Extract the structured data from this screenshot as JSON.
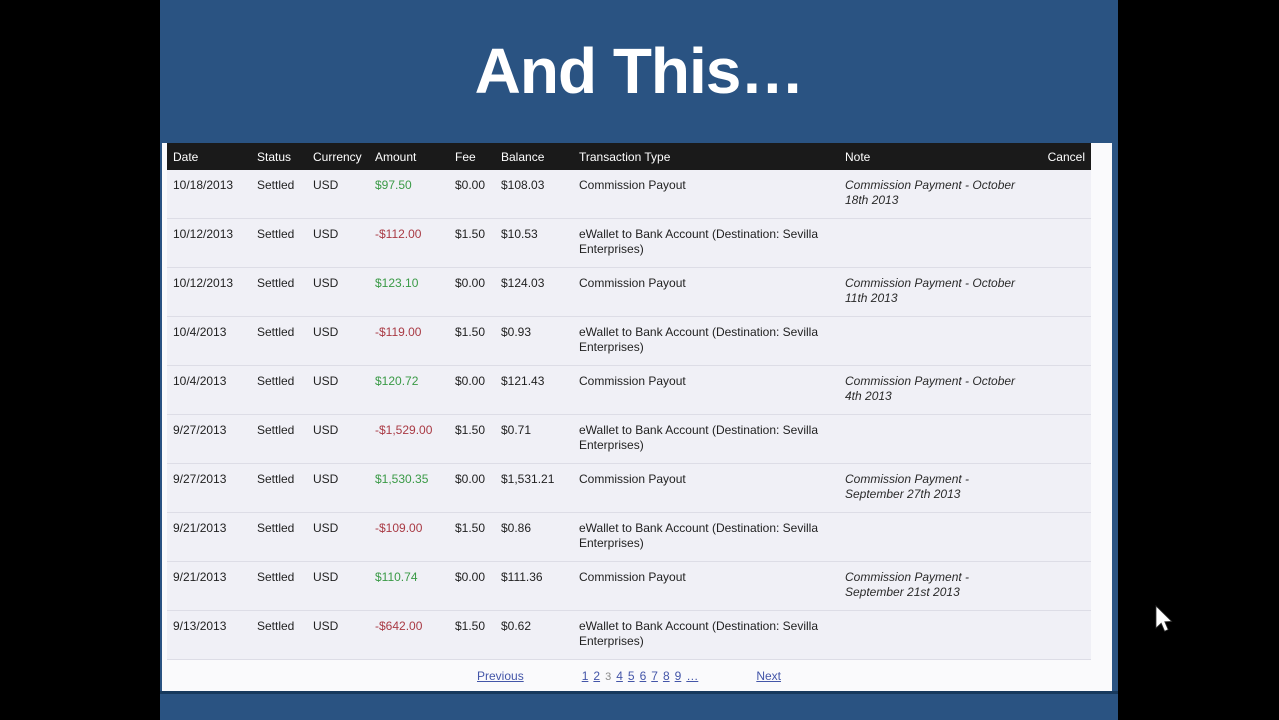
{
  "slide": {
    "title": "And This…"
  },
  "table": {
    "headers": {
      "date": "Date",
      "status": "Status",
      "currency": "Currency",
      "amount": "Amount",
      "fee": "Fee",
      "balance": "Balance",
      "type": "Transaction Type",
      "note": "Note",
      "cancel": "Cancel"
    },
    "rows": [
      {
        "date": "10/18/2013",
        "status": "Settled",
        "currency": "USD",
        "amount": "$97.50",
        "fee": "$0.00",
        "balance": "$108.03",
        "type": "Commission Payout",
        "note": "Commission Payment - October 18th 2013",
        "cancel": ""
      },
      {
        "date": "10/12/2013",
        "status": "Settled",
        "currency": "USD",
        "amount": "-$112.00",
        "fee": "$1.50",
        "balance": "$10.53",
        "type": "eWallet to Bank Account (Destination: Sevilla Enterprises)",
        "note": "",
        "cancel": ""
      },
      {
        "date": "10/12/2013",
        "status": "Settled",
        "currency": "USD",
        "amount": "$123.10",
        "fee": "$0.00",
        "balance": "$124.03",
        "type": "Commission Payout",
        "note": "Commission Payment - October 11th 2013",
        "cancel": ""
      },
      {
        "date": "10/4/2013",
        "status": "Settled",
        "currency": "USD",
        "amount": "-$119.00",
        "fee": "$1.50",
        "balance": "$0.93",
        "type": "eWallet to Bank Account (Destination: Sevilla Enterprises)",
        "note": "",
        "cancel": ""
      },
      {
        "date": "10/4/2013",
        "status": "Settled",
        "currency": "USD",
        "amount": "$120.72",
        "fee": "$0.00",
        "balance": "$121.43",
        "type": "Commission Payout",
        "note": "Commission Payment - October 4th 2013",
        "cancel": ""
      },
      {
        "date": "9/27/2013",
        "status": "Settled",
        "currency": "USD",
        "amount": "-$1,529.00",
        "fee": "$1.50",
        "balance": "$0.71",
        "type": "eWallet to Bank Account (Destination: Sevilla Enterprises)",
        "note": "",
        "cancel": ""
      },
      {
        "date": "9/27/2013",
        "status": "Settled",
        "currency": "USD",
        "amount": "$1,530.35",
        "fee": "$0.00",
        "balance": "$1,531.21",
        "type": "Commission Payout",
        "note": "Commission Payment - September 27th 2013",
        "cancel": ""
      },
      {
        "date": "9/21/2013",
        "status": "Settled",
        "currency": "USD",
        "amount": "-$109.00",
        "fee": "$1.50",
        "balance": "$0.86",
        "type": "eWallet to Bank Account (Destination: Sevilla Enterprises)",
        "note": "",
        "cancel": ""
      },
      {
        "date": "9/21/2013",
        "status": "Settled",
        "currency": "USD",
        "amount": "$110.74",
        "fee": "$0.00",
        "balance": "$111.36",
        "type": "Commission Payout",
        "note": "Commission Payment - September 21st 2013",
        "cancel": ""
      },
      {
        "date": "9/13/2013",
        "status": "Settled",
        "currency": "USD",
        "amount": "-$642.00",
        "fee": "$1.50",
        "balance": "$0.62",
        "type": "eWallet to Bank Account (Destination: Sevilla Enterprises)",
        "note": "",
        "cancel": ""
      }
    ]
  },
  "pagination": {
    "previous": "Previous",
    "pages": [
      "1",
      "2",
      "3",
      "4",
      "5",
      "6",
      "7",
      "8",
      "9",
      "…"
    ],
    "current": "3",
    "next": "Next"
  },
  "colors": {
    "slide_background": "#2A5382",
    "bottom_divider": "#17395D",
    "table_header_background": "#1A1A1A",
    "row_background": "#F0F0F6",
    "amount_positive": "#3A9A46",
    "amount_negative": "#A93A44",
    "link_blue": "#4355A8"
  }
}
